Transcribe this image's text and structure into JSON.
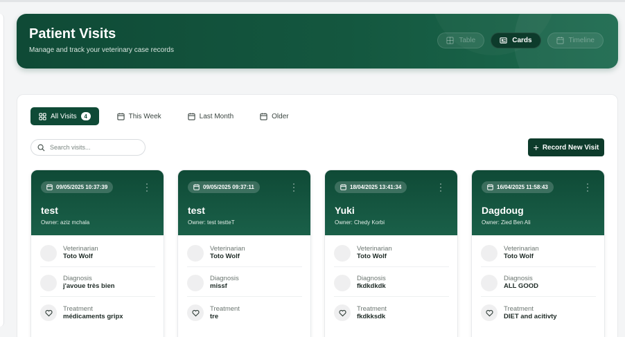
{
  "header": {
    "title": "Patient Visits",
    "subtitle": "Manage and track your veterinary case records",
    "views": [
      {
        "label": "Table",
        "icon": "table-icon",
        "active": false
      },
      {
        "label": "Cards",
        "icon": "cards-icon",
        "active": true
      },
      {
        "label": "Timeline",
        "icon": "timeline-icon",
        "active": false
      }
    ]
  },
  "filters": {
    "all": {
      "label": "All Visits",
      "count": "4"
    },
    "week": {
      "label": "This Week"
    },
    "month": {
      "label": "Last Month"
    },
    "older": {
      "label": "Older"
    }
  },
  "search": {
    "placeholder": "Search visits..."
  },
  "record_button": {
    "label": "Record New Visit"
  },
  "labels": {
    "veterinarian": "Veterinarian",
    "diagnosis": "Diagnosis",
    "treatment": "Treatment"
  },
  "cards": [
    {
      "date": "09/05/2025 10:37:39",
      "name": "test",
      "owner": "Owner: aziz mchala",
      "veterinarian": "Toto Wolf",
      "diagnosis": "j'avoue très bien",
      "treatment": "médicaments gripx"
    },
    {
      "date": "09/05/2025 09:37:11",
      "name": "test",
      "owner": "Owner: test testteT",
      "veterinarian": "Toto Wolf",
      "diagnosis": "missf",
      "treatment": "tre"
    },
    {
      "date": "18/04/2025 13:41:34",
      "name": "Yuki",
      "owner": "Owner: Chedy Korbi",
      "veterinarian": "Toto Wolf",
      "diagnosis": "fkdkdkdk",
      "treatment": "fkdkksdk"
    },
    {
      "date": "16/04/2025 11:58:43",
      "name": "Dagdoug",
      "owner": "Owner: Zied Ben Ali",
      "veterinarian": "Toto Wolf",
      "diagnosis": "ALL GOOD",
      "treatment": "DIET and acitivty"
    }
  ],
  "colors": {
    "brand_dark": "#0d3b2b",
    "brand": "#0f4a36",
    "brand_light": "#1c6a4e"
  }
}
